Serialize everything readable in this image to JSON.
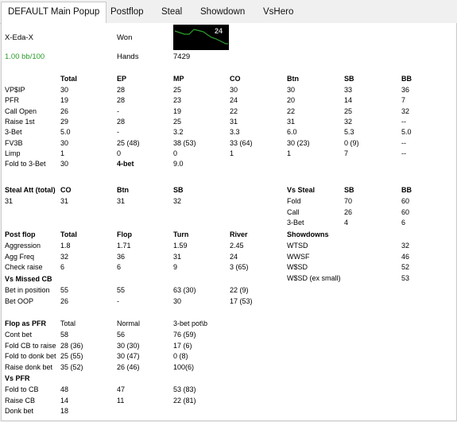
{
  "tabs": [
    "DEFAULT Main Popup",
    "Postflop",
    "Steal",
    "Showdown",
    "VsHero"
  ],
  "player": "X-Eda-X",
  "won_label": "Won",
  "winrate": "1.00 bb/100",
  "hands_label": "Hands",
  "hands_value": "7429",
  "graph_value": "24",
  "colors": {
    "graph_line": "#2ea12e",
    "winrate": "#2a9b2a",
    "graph_bg": "#000000"
  },
  "preflop": {
    "headers": [
      "Total",
      "EP",
      "MP",
      "CO",
      "Btn",
      "SB",
      "BB"
    ],
    "rows": [
      [
        "VP$IP",
        "30",
        "28",
        "25",
        "30",
        "30",
        "33",
        "36"
      ],
      [
        "PFR",
        "19",
        "28",
        "23",
        "24",
        "20",
        "14",
        "7"
      ],
      [
        "Call Open",
        "26",
        "-",
        "19",
        "22",
        "22",
        "25",
        "32"
      ],
      [
        "Raise 1st",
        "29",
        "28",
        "25",
        "31",
        "31",
        "32",
        "--"
      ],
      [
        "3-Bet",
        "5.0",
        "-",
        "3.2",
        "3.3",
        "6.0",
        "5.3",
        "5.0"
      ],
      [
        "FV3B",
        "30",
        "25 (48)",
        "38 (53)",
        "33 (64)",
        "30 (23)",
        "0 (9)",
        "--"
      ],
      [
        "Limp",
        "1",
        "0",
        "0",
        "1",
        "1",
        "7",
        "--"
      ],
      [
        "Fold to 3-Bet",
        "30",
        "4-bet",
        "9.0",
        "",
        "",
        "",
        ""
      ]
    ]
  },
  "steal": {
    "headers": [
      "Steal Att (total)",
      "CO",
      "Btn",
      "SB"
    ],
    "values": [
      "31",
      "31",
      "31",
      "32"
    ]
  },
  "vs_steal": {
    "headers": [
      "Vs Steal",
      "SB",
      "BB"
    ],
    "rows": [
      [
        "Fold",
        "70",
        "60"
      ],
      [
        "Call",
        "26",
        "60"
      ],
      [
        "3-Bet",
        "4",
        "6"
      ]
    ]
  },
  "postflop": {
    "headers": [
      "Post flop",
      "Total",
      "Flop",
      "Turn",
      "River"
    ],
    "rows": [
      [
        "Aggression",
        "1.8",
        "1.71",
        "1.59",
        "2.45"
      ],
      [
        "Agg Freq",
        "32",
        "36",
        "31",
        "24"
      ],
      [
        "Check raise",
        "6",
        "6",
        "9",
        "3 (65)"
      ]
    ]
  },
  "showdowns": {
    "header": "Showdowns",
    "rows": [
      [
        "WTSD",
        "32"
      ],
      [
        "WWSF",
        "46"
      ],
      [
        "W$SD",
        "52"
      ],
      [
        "W$SD (ex small)",
        "53"
      ]
    ]
  },
  "missed_cb": {
    "header": "Vs Missed CB",
    "rows": [
      [
        "Bet in position",
        "55",
        "55",
        "63 (30)",
        "22 (9)"
      ],
      [
        "Bet OOP",
        "26",
        "-",
        "30",
        "17 (53)"
      ]
    ]
  },
  "flop_pfr": {
    "headers": [
      "Flop as PFR",
      "Total",
      "Normal",
      "3-bet pot\\b"
    ],
    "rows": [
      [
        "Cont bet",
        "58",
        "56",
        "76 (59)"
      ],
      [
        "Fold CB to raise",
        "28 (36)",
        "30 (30)",
        "17 (6)"
      ],
      [
        "Fold to donk bet",
        "25 (55)",
        "30 (47)",
        "0 (8)"
      ],
      [
        "Raise donk bet",
        "35 (52)",
        "26 (46)",
        "100(6)"
      ]
    ]
  },
  "vs_pfr": {
    "header": "Vs PFR",
    "rows": [
      [
        "Fold to CB",
        "48",
        "47",
        "53 (83)"
      ],
      [
        "Raise CB",
        "14",
        "11",
        "22 (81)"
      ],
      [
        "Donk bet",
        "18",
        "",
        ""
      ]
    ]
  }
}
